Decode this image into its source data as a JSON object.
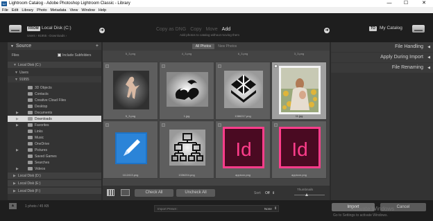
{
  "window": {
    "title": "Lightroom Catalog - Adobe Photoshop Lightroom Classic - Library",
    "logo": "Lr",
    "minimize": "—",
    "maximize": "☐",
    "close": "✕"
  },
  "menu": [
    "File",
    "Edit",
    "Library",
    "Photo",
    "Metadata",
    "View",
    "Window",
    "Help"
  ],
  "header": {
    "from_badge": "FROM",
    "source_name": "Local Disk (C:)",
    "source_path": "Users › 91955 › Downloads ›",
    "modes": [
      "Copy as DNG",
      "Copy",
      "Move",
      "Add"
    ],
    "active_mode": "Add",
    "mode_subtitle": "Add photos to catalog without moving them",
    "to_badge": "TO",
    "destination": "My Catalog"
  },
  "source_panel": {
    "title": "Source",
    "add": "+",
    "files_label": "Files",
    "include_subfolders": "Include Subfolders",
    "drive_c": "Local Disk (C:)",
    "users": "Users",
    "user": "91955",
    "folders": [
      "3D Objects",
      "Contacts",
      "Creative Cloud Files",
      "Desktop",
      "Documents",
      "Downloads",
      "Favorites",
      "Links",
      "Music",
      "OneDrive",
      "Pictures",
      "Saved Games",
      "Searches",
      "Videos"
    ],
    "selected_folder": "Downloads",
    "drive_d": "Local Disk (D:)",
    "drive_e": "Local Disk (E:)",
    "drive_f": "Local Disk (F:)"
  },
  "grid": {
    "tabs": [
      "All Photos",
      "New Photos"
    ],
    "active_tab": "All Photos",
    "top_labels": [
      "5_3.png",
      "4_3.png",
      "6_3.png",
      "3_3.png"
    ],
    "cells": [
      {
        "name": "5_3.png",
        "checked": false
      },
      {
        "name": "1.jpg",
        "checked": false
      },
      {
        "name": "1386217.png",
        "checked": false
      },
      {
        "name": "11.jpg",
        "checked": true
      },
      {
        "name": "1112413.png",
        "checked": false
      },
      {
        "name": "1336204.png",
        "checked": false
      },
      {
        "name": "appicon.png",
        "checked": false
      },
      {
        "name": "appicon.png",
        "checked": false
      }
    ]
  },
  "grid_toolbar": {
    "check_all": "Check All",
    "uncheck_all": "Uncheck All",
    "sort_label": "Sort:",
    "sort_value": "Off",
    "thumbnails_label": "Thumbnails"
  },
  "right_panel": {
    "file_handling": "File Handling",
    "apply_during_import": "Apply During Import",
    "file_renaming": "File Renaming"
  },
  "bottom": {
    "info": "1 photo / 45 KB",
    "preset_label": "Import Preset :",
    "preset_value": "None",
    "import_button": "Import",
    "cancel_button": "Cancel",
    "watermark_title": "Activate Windows",
    "watermark_sub": "Go to Settings to activate Windows."
  },
  "colors": {
    "idpink": "#ff3d8b",
    "iddark": "#4a0a22",
    "blue": "#1e73c6"
  }
}
